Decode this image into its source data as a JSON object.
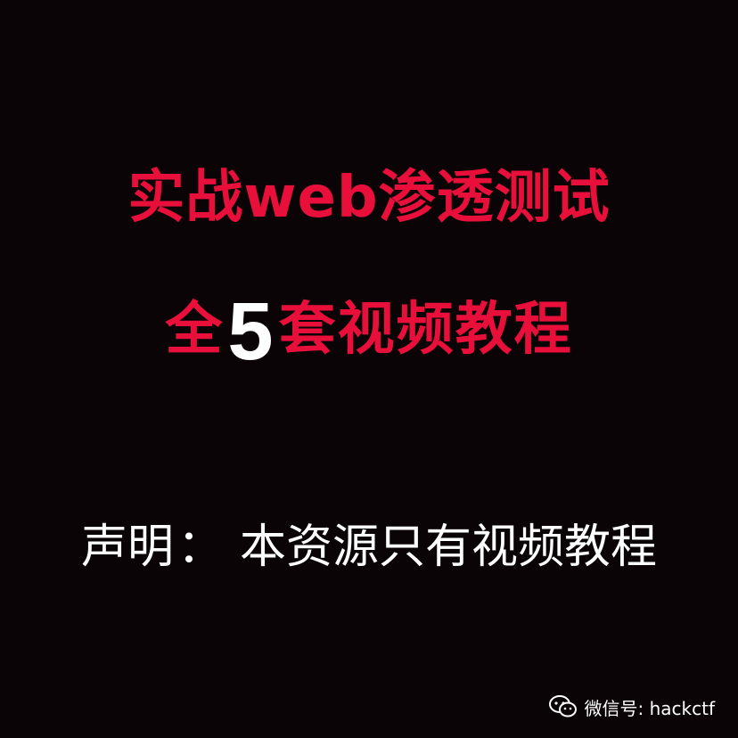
{
  "poster": {
    "title_line_1": "实战web渗透测试",
    "title_line_2_prefix": "全",
    "title_line_2_number": "5",
    "title_line_2_suffix": "套视频教程",
    "disclaimer_label": "声明",
    "disclaimer_colon": "：",
    "disclaimer_text": "本资源只有视频教程"
  },
  "watermark": {
    "icon": "wechat-icon",
    "text": "微信号: hackctf"
  },
  "colors": {
    "background": "#0a0407",
    "title_red": "#e8103a",
    "white": "#ffffff"
  }
}
